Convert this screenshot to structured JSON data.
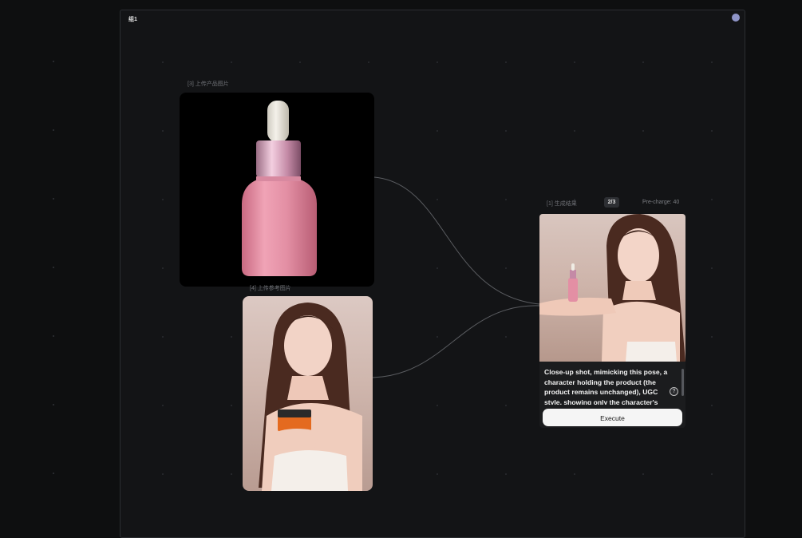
{
  "group": {
    "title": "组1"
  },
  "nodes": {
    "product": {
      "label": "[3] 上传产品图片"
    },
    "model": {
      "label": "[4] 上传参考图片"
    },
    "result": {
      "label": "[1] 生成结果",
      "badge": "2/3",
      "precharge": "Pre-charge: 40",
      "prompt": "Close-up shot, mimicking this pose, a character holding the product (the product remains unchanged), UGC style, showing only the character's upper body",
      "execute_label": "Execute",
      "help_glyph": "?"
    }
  },
  "icons": {
    "group_dot": "status-dot-icon"
  },
  "colors": {
    "accent_dot": "#8f95c8",
    "bottle_pink": "#e38fa4",
    "jar_orange": "#e46a1f"
  }
}
